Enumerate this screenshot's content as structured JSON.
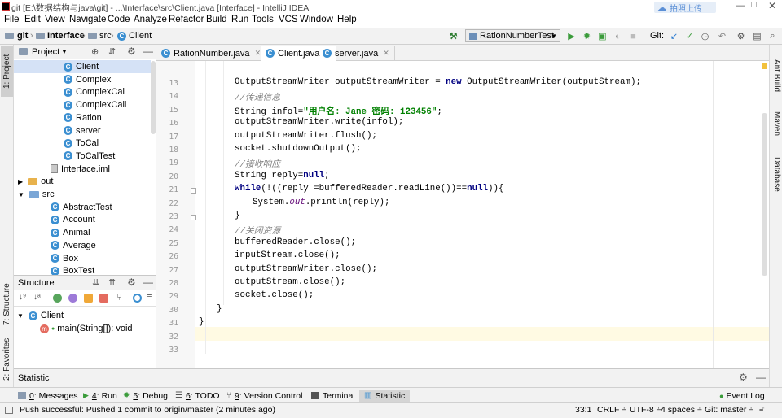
{
  "window": {
    "title": "git [E:\\数据结构与java\\git] - ...\\Interface\\src\\Client.java [Interface] - IntelliJ IDEA",
    "cloud_label": "拍照上传"
  },
  "menu": [
    "File",
    "Edit",
    "View",
    "Navigate",
    "Code",
    "Analyze",
    "Refactor",
    "Build",
    "Run",
    "Tools",
    "VCS",
    "Window",
    "Help"
  ],
  "nav": {
    "crumbs": [
      "git",
      "Interface",
      "src",
      "Client"
    ],
    "run_config": "RationNumberTest",
    "git_label": "Git:"
  },
  "left_strip": {
    "project": "1: Project",
    "structure": "7: Structure",
    "favorites": "2: Favorites"
  },
  "project": {
    "title": "Project",
    "items": [
      {
        "label": "Client",
        "kind": "class",
        "level": 2,
        "selected": true
      },
      {
        "label": "Complex",
        "kind": "class",
        "level": 2
      },
      {
        "label": "ComplexCal",
        "kind": "class",
        "level": 2
      },
      {
        "label": "ComplexCall",
        "kind": "class",
        "level": 2
      },
      {
        "label": "Ration",
        "kind": "class",
        "level": 2
      },
      {
        "label": "server",
        "kind": "class",
        "level": 2
      },
      {
        "label": "ToCal",
        "kind": "class",
        "level": 2
      },
      {
        "label": "ToCalTest",
        "kind": "class",
        "level": 2
      },
      {
        "label": "Interface.iml",
        "kind": "file",
        "level": 1
      },
      {
        "label": "out",
        "kind": "folder-collapsed",
        "level": 0
      },
      {
        "label": "src",
        "kind": "folder-open",
        "level": 0
      },
      {
        "label": "AbstractTest",
        "kind": "class",
        "level": 1
      },
      {
        "label": "Account",
        "kind": "class",
        "level": 1
      },
      {
        "label": "Animal",
        "kind": "class",
        "level": 1
      },
      {
        "label": "Average",
        "kind": "class",
        "level": 1
      },
      {
        "label": "Box",
        "kind": "class",
        "level": 1
      },
      {
        "label": "BoxTest",
        "kind": "class",
        "level": 1
      }
    ]
  },
  "structure": {
    "title": "Structure",
    "items": [
      {
        "label": "Client",
        "kind": "class"
      },
      {
        "label": "main(String[]): void",
        "kind": "method"
      }
    ]
  },
  "editor": {
    "tabs": [
      {
        "label": "RationNumber.java",
        "active": false
      },
      {
        "label": "Client.java",
        "active": true
      },
      {
        "label": "server.java",
        "active": false
      }
    ],
    "lines": [
      {
        "n": "13",
        "indent": 2,
        "tokens": [
          {
            "t": "OutputStreamWriter outputStreamWriter = "
          },
          {
            "t": "new",
            "c": "kw"
          },
          {
            "t": " OutputStreamWriter(outputStream);"
          }
        ]
      },
      {
        "n": "14",
        "indent": 2,
        "tokens": [
          {
            "t": "//传递信息",
            "c": "cmt"
          }
        ]
      },
      {
        "n": "15",
        "indent": 2,
        "tokens": [
          {
            "t": "String infol="
          },
          {
            "t": "\"用户名: Jane 密码: 123456\"",
            "c": "str"
          },
          {
            "t": ";"
          }
        ]
      },
      {
        "n": "16",
        "indent": 2,
        "tokens": [
          {
            "t": "outputStreamWriter.write(infol);"
          }
        ]
      },
      {
        "n": "17",
        "indent": 2,
        "tokens": [
          {
            "t": "outputStreamWriter.flush();"
          }
        ]
      },
      {
        "n": "18",
        "indent": 2,
        "tokens": [
          {
            "t": "socket.shutdownOutput();"
          }
        ]
      },
      {
        "n": "19",
        "indent": 2,
        "tokens": [
          {
            "t": "//接收响应",
            "c": "cmt"
          }
        ]
      },
      {
        "n": "20",
        "indent": 2,
        "tokens": [
          {
            "t": "String reply="
          },
          {
            "t": "null",
            "c": "kw"
          },
          {
            "t": ";"
          }
        ]
      },
      {
        "n": "21",
        "indent": 2,
        "tokens": [
          {
            "t": "while",
            "c": "kw"
          },
          {
            "t": "(!((reply =bufferedReader.readLine())=="
          },
          {
            "t": "null",
            "c": "kw"
          },
          {
            "t": ")){"
          }
        ]
      },
      {
        "n": "22",
        "indent": 3,
        "tokens": [
          {
            "t": "System."
          },
          {
            "t": "out",
            "c": "fld"
          },
          {
            "t": ".println(reply);"
          }
        ]
      },
      {
        "n": "23",
        "indent": 2,
        "tokens": [
          {
            "t": "}"
          }
        ]
      },
      {
        "n": "24",
        "indent": 2,
        "tokens": [
          {
            "t": "//关闭资源",
            "c": "cmt"
          }
        ]
      },
      {
        "n": "25",
        "indent": 2,
        "tokens": [
          {
            "t": "bufferedReader.close();"
          }
        ]
      },
      {
        "n": "26",
        "indent": 2,
        "tokens": [
          {
            "t": "inputStream.close();"
          }
        ]
      },
      {
        "n": "27",
        "indent": 2,
        "tokens": [
          {
            "t": "outputStreamWriter.close();"
          }
        ]
      },
      {
        "n": "28",
        "indent": 2,
        "tokens": [
          {
            "t": "outputStream.close();"
          }
        ]
      },
      {
        "n": "29",
        "indent": 2,
        "tokens": [
          {
            "t": "socket.close();"
          }
        ]
      },
      {
        "n": "30",
        "indent": 1,
        "tokens": [
          {
            "t": "}"
          }
        ]
      },
      {
        "n": "31",
        "indent": 0,
        "tokens": [
          {
            "t": "}"
          }
        ]
      },
      {
        "n": "32",
        "indent": 0,
        "tokens": []
      },
      {
        "n": "33",
        "indent": 0,
        "tokens": [],
        "current": true
      }
    ]
  },
  "right_strip": [
    "Ant Build",
    "Maven",
    "Database"
  ],
  "statistic": {
    "title": "Statistic"
  },
  "bottom_tabs": [
    {
      "num": "0",
      "label": ": Messages"
    },
    {
      "num": "4",
      "label": ": Run"
    },
    {
      "num": "5",
      "label": ": Debug"
    },
    {
      "num": "6",
      "label": ": TODO"
    },
    {
      "num": "9",
      "label": ": Version Control"
    },
    {
      "num": "",
      "label": "Terminal"
    },
    {
      "num": "",
      "label": "Statistic"
    }
  ],
  "event_log": "Event Log",
  "status": {
    "message": "Push successful: Pushed 1 commit to origin/master (2 minutes ago)",
    "position": "33:1",
    "line_sep": "CRLF ÷",
    "encoding": "UTF-8 ÷",
    "indent": "4 spaces ÷",
    "branch": "Git: master ÷"
  },
  "colors": {
    "accent": "#3b8fd1",
    "selection": "#d5e2f6",
    "current_line": "#fffae3",
    "comment": "#808080",
    "keyword": "#000080",
    "string": "#008000"
  }
}
